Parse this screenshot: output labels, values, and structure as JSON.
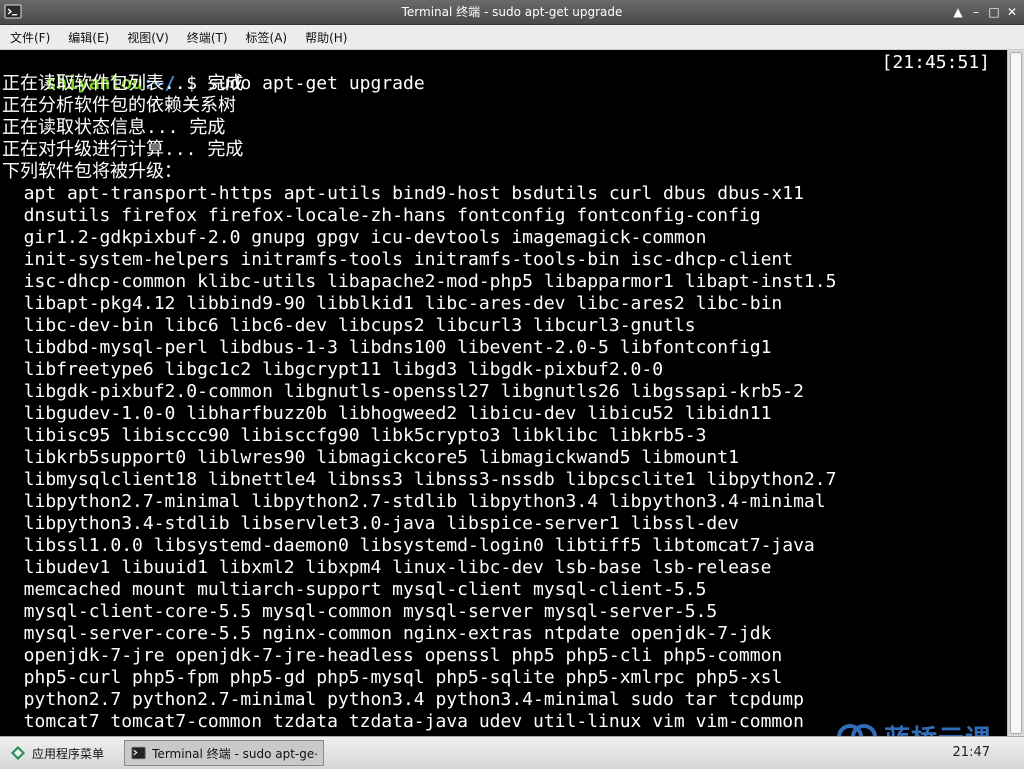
{
  "window": {
    "title": "Terminal 终端 - sudo apt-get upgrade"
  },
  "menu": [
    "文件(F)",
    "编辑(E)",
    "视图(V)",
    "终端(T)",
    "标签(A)",
    "帮助(H)"
  ],
  "terminal": {
    "prompt_user": "shiyanlou",
    "prompt_path": ":~/",
    "command": " $ sudo apt-get upgrade",
    "timestamp": "[21:45:51]",
    "lines": [
      "正在读取软件包列表... 完成",
      "正在分析软件包的依赖关系树",
      "正在读取状态信息... 完成",
      "正在对升级进行计算... 完成",
      "下列软件包将被升级：",
      "  apt apt-transport-https apt-utils bind9-host bsdutils curl dbus dbus-x11",
      "  dnsutils firefox firefox-locale-zh-hans fontconfig fontconfig-config",
      "  gir1.2-gdkpixbuf-2.0 gnupg gpgv icu-devtools imagemagick-common",
      "  init-system-helpers initramfs-tools initramfs-tools-bin isc-dhcp-client",
      "  isc-dhcp-common klibc-utils libapache2-mod-php5 libapparmor1 libapt-inst1.5",
      "  libapt-pkg4.12 libbind9-90 libblkid1 libc-ares-dev libc-ares2 libc-bin",
      "  libc-dev-bin libc6 libc6-dev libcups2 libcurl3 libcurl3-gnutls",
      "  libdbd-mysql-perl libdbus-1-3 libdns100 libevent-2.0-5 libfontconfig1",
      "  libfreetype6 libgc1c2 libgcrypt11 libgd3 libgdk-pixbuf2.0-0",
      "  libgdk-pixbuf2.0-common libgnutls-openssl27 libgnutls26 libgssapi-krb5-2",
      "  libgudev-1.0-0 libharfbuzz0b libhogweed2 libicu-dev libicu52 libidn11",
      "  libisc95 libisccc90 libisccfg90 libk5crypto3 libklibc libkrb5-3",
      "  libkrb5support0 liblwres90 libmagickcore5 libmagickwand5 libmount1",
      "  libmysqlclient18 libnettle4 libnss3 libnss3-nssdb libpcsclite1 libpython2.7",
      "  libpython2.7-minimal libpython2.7-stdlib libpython3.4 libpython3.4-minimal",
      "  libpython3.4-stdlib libservlet3.0-java libspice-server1 libssl-dev",
      "  libssl1.0.0 libsystemd-daemon0 libsystemd-login0 libtiff5 libtomcat7-java",
      "  libudev1 libuuid1 libxml2 libxpm4 linux-libc-dev lsb-base lsb-release",
      "  memcached mount multiarch-support mysql-client mysql-client-5.5",
      "  mysql-client-core-5.5 mysql-common mysql-server mysql-server-5.5",
      "  mysql-server-core-5.5 nginx-common nginx-extras ntpdate openjdk-7-jdk",
      "  openjdk-7-jre openjdk-7-jre-headless openssl php5 php5-cli php5-common",
      "  php5-curl php5-fpm php5-gd php5-mysql php5-sqlite php5-xmlrpc php5-xsl",
      "  python2.7 python2.7-minimal python3.4 python3.4-minimal sudo tar tcpdump",
      "  tomcat7 tomcat7-common tzdata tzdata-java udev util-linux vim vim-common"
    ]
  },
  "taskbar": {
    "start_label": "应用程序菜单",
    "task_label": "Terminal 终端 - sudo apt-ge⋯",
    "clock": "21:47"
  },
  "watermark": {
    "text": "蓝桥云课"
  },
  "colors": {
    "prompt_user": "#7ed321",
    "prompt_path": "#4a90e2",
    "terminal_bg": "#000000"
  }
}
